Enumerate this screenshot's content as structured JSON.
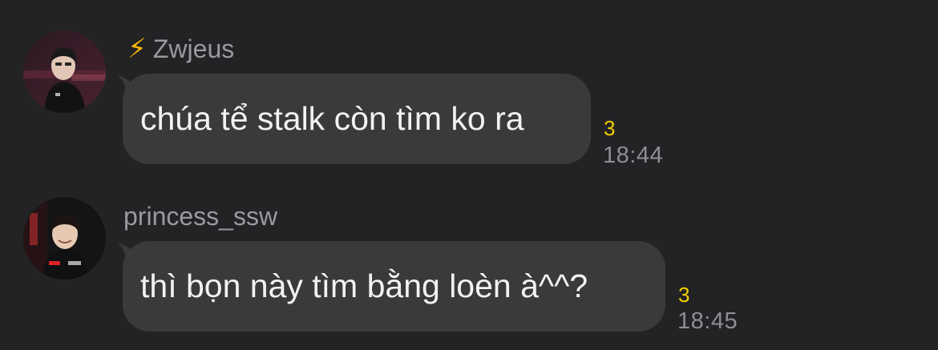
{
  "messages": [
    {
      "sender_icon": "lightning-bolt-icon",
      "sender_emoji": "⚡",
      "sender": "Zwjeus",
      "text": "chúa tể stalk còn tìm ko ra",
      "reaction_count": "3",
      "time": "18:44"
    },
    {
      "sender": "princess_ssw",
      "text": "thì bọn này tìm bằng loèn à^^?",
      "reaction_count": "3",
      "time": "18:45"
    }
  ],
  "colors": {
    "background": "#232325",
    "bubble": "#3a3a3c",
    "sender_name": "#9a9a9e",
    "message_text": "#f2f2f2",
    "reaction_count": "#f5d000",
    "timestamp": "#8e8e93"
  }
}
